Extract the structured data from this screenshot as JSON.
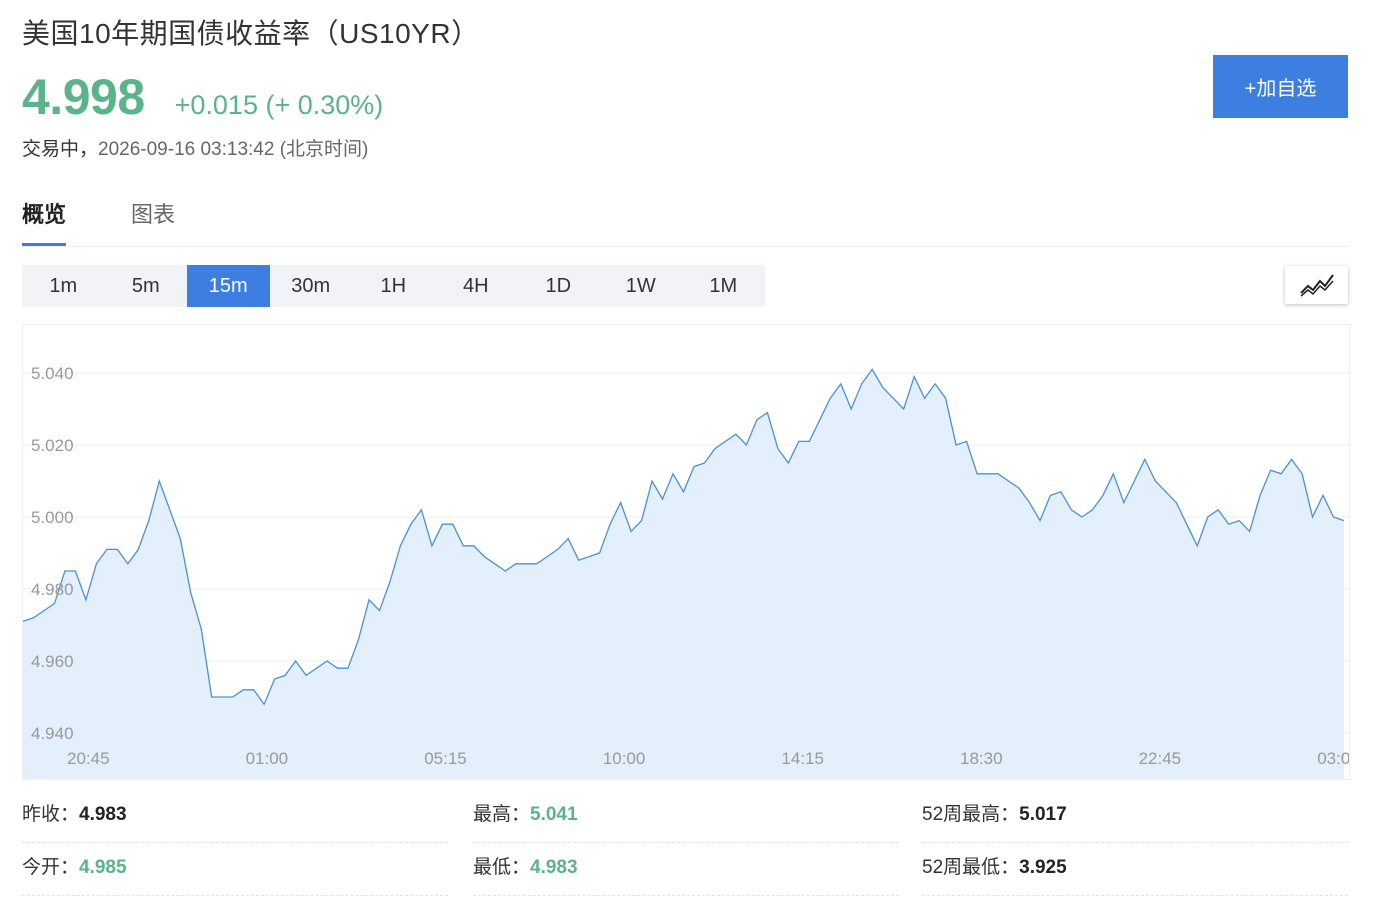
{
  "header": {
    "title": "美国10年期国债收益率（US10YR）",
    "price": "4.998",
    "change": "+0.015 (+ 0.30%)",
    "status_prefix": "交易中，",
    "timestamp": "2026-09-16 03:13:42 (北京时间)",
    "add_button": "+加自选"
  },
  "tabs": [
    {
      "label": "概览",
      "active": true
    },
    {
      "label": "图表",
      "active": false
    }
  ],
  "periods": [
    {
      "label": "1m",
      "active": false
    },
    {
      "label": "5m",
      "active": false
    },
    {
      "label": "15m",
      "active": true
    },
    {
      "label": "30m",
      "active": false
    },
    {
      "label": "1H",
      "active": false
    },
    {
      "label": "4H",
      "active": false
    },
    {
      "label": "1D",
      "active": false
    },
    {
      "label": "1W",
      "active": false
    },
    {
      "label": "1M",
      "active": false
    }
  ],
  "icons": {
    "chart_type": "line-chart-icon"
  },
  "colors": {
    "up": "#5bb38a",
    "accent": "#3c7fe0",
    "line": "#4a90d9",
    "area": "#e3effb"
  },
  "chart_data": {
    "type": "area",
    "title": "",
    "xlabel": "",
    "ylabel": "",
    "x_ticks": [
      "20:45",
      "01:00",
      "05:15",
      "10:00",
      "14:15",
      "18:30",
      "22:45",
      "03:0"
    ],
    "y_ticks": [
      "4.940",
      "4.960",
      "4.980",
      "5.000",
      "5.020",
      "5.040"
    ],
    "ylim": [
      4.935,
      5.05
    ],
    "grid": true,
    "series": [
      {
        "values": [
          4.971,
          4.972,
          4.974,
          4.976,
          4.985,
          4.985,
          4.977,
          4.987,
          4.991,
          4.991,
          4.987,
          4.991,
          4.999,
          5.01,
          5.002,
          4.994,
          4.979,
          4.969,
          4.95,
          4.95,
          4.95,
          4.952,
          4.952,
          4.948,
          4.955,
          4.956,
          4.96,
          4.956,
          4.958,
          4.96,
          4.958,
          4.958,
          4.966,
          4.977,
          4.974,
          4.982,
          4.992,
          4.998,
          5.002,
          4.992,
          4.998,
          4.998,
          4.992,
          4.992,
          4.989,
          4.987,
          4.985,
          4.987,
          4.987,
          4.987,
          4.989,
          4.991,
          4.994,
          4.988,
          4.989,
          4.99,
          4.998,
          5.004,
          4.996,
          4.999,
          5.01,
          5.005,
          5.012,
          5.007,
          5.014,
          5.015,
          5.019,
          5.021,
          5.023,
          5.02,
          5.027,
          5.029,
          5.019,
          5.015,
          5.021,
          5.021,
          5.027,
          5.033,
          5.037,
          5.03,
          5.037,
          5.041,
          5.036,
          5.033,
          5.03,
          5.039,
          5.033,
          5.037,
          5.033,
          5.02,
          5.021,
          5.012,
          5.012,
          5.012,
          5.01,
          5.008,
          5.004,
          4.999,
          5.006,
          5.007,
          5.002,
          5.0,
          5.002,
          5.006,
          5.012,
          5.004,
          5.01,
          5.016,
          5.01,
          5.007,
          5.004,
          4.998,
          4.992,
          5.0,
          5.002,
          4.998,
          4.999,
          4.996,
          5.006,
          5.013,
          5.012,
          5.016,
          5.012,
          5.0,
          5.006,
          5.0,
          4.999
        ]
      }
    ]
  },
  "stats": [
    {
      "label": "昨收：",
      "value": "4.983",
      "tone": "dark"
    },
    {
      "label": "最高：",
      "value": "5.041",
      "tone": "up"
    },
    {
      "label": "52周最高：",
      "value": "5.017",
      "tone": "dark"
    },
    {
      "label": "今开：",
      "value": "4.985",
      "tone": "up"
    },
    {
      "label": "最低：",
      "value": "4.983",
      "tone": "up"
    },
    {
      "label": "52周最低：",
      "value": "3.925",
      "tone": "dark"
    }
  ]
}
